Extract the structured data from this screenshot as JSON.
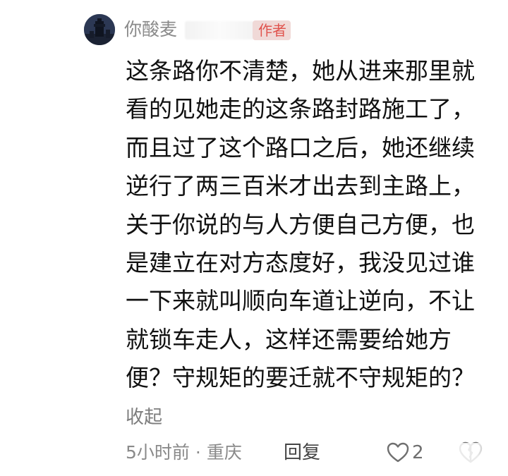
{
  "comment": {
    "username": "你酸麦",
    "author_badge": "作者",
    "text_lines": [
      "这条路你不清楚，她从进来那里就",
      "看的见她走的这条路封路施工了，",
      "而且过了这个路口之后，她还继续",
      "逆行了两三百米才出去到主路上，",
      "关于你说的与人方便自己方便，也",
      "是建立在对方态度好，我没见过谁",
      "一下来就叫顺向车道让逆向，不让",
      "就锁车走人，这样还需要给她方",
      "便？守规矩的要迁就不守规矩的？"
    ],
    "collapse_label": "收起",
    "time": "5小时前",
    "separator": "·",
    "location": "重庆",
    "reply_label": "回复",
    "like_count": "2",
    "icons": {
      "like": "heart-outline-icon",
      "dislike": "broken-heart-outline-icon"
    },
    "colors": {
      "badge_bg": "#f0d9d7",
      "badge_text": "#e0534d",
      "body_text": "#111111",
      "meta_text": "#8a8a8a"
    }
  }
}
